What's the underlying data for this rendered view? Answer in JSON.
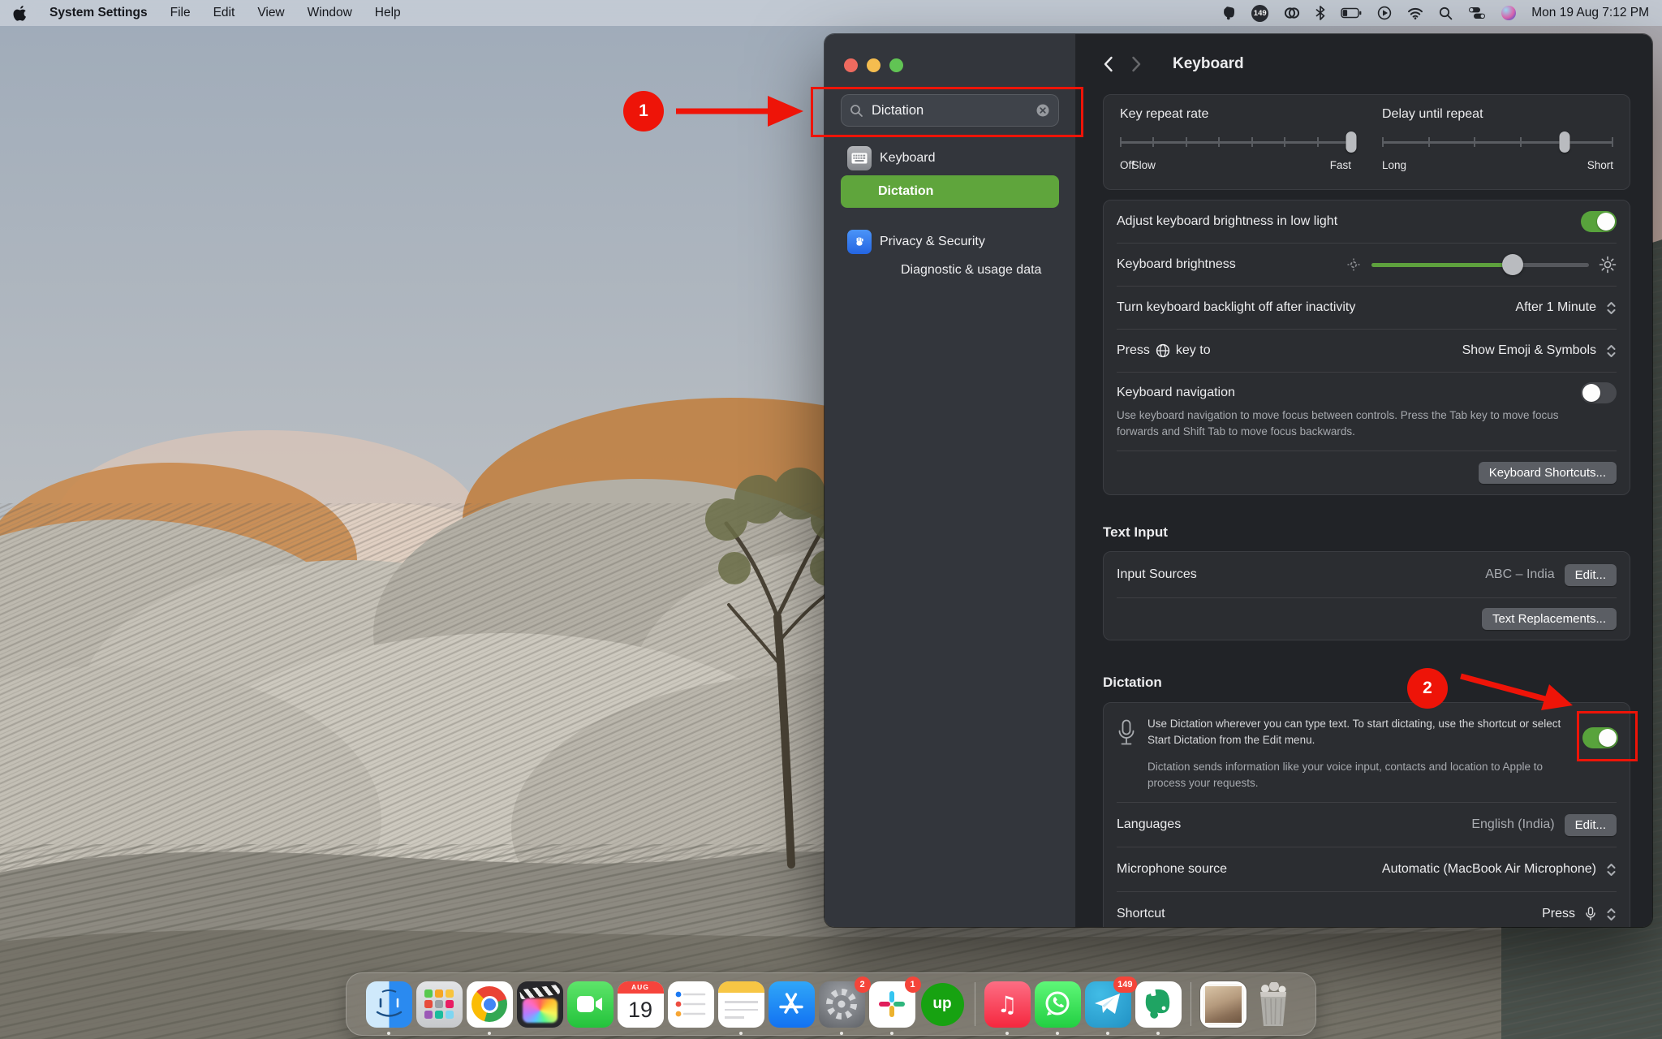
{
  "menubar": {
    "app_name": "System Settings",
    "menus": [
      "File",
      "Edit",
      "View",
      "Window",
      "Help"
    ],
    "status": {
      "telegram_badge": "149"
    },
    "clock": "Mon 19 Aug 7:12 PM"
  },
  "sidebar": {
    "search_value": "Dictation",
    "result1_parent": "Keyboard",
    "result1_child": "Dictation",
    "result2_parent": "Privacy & Security",
    "result2_child": "Diagnostic & usage data"
  },
  "main": {
    "title": "Keyboard",
    "repeat": {
      "label1": "Key repeat rate",
      "off": "Off",
      "slow": "Slow",
      "fast": "Fast",
      "key_repeat_pct": 100,
      "label2": "Delay until repeat",
      "long": "Long",
      "short": "Short",
      "delay_pct": 79
    },
    "opts": {
      "brightness_low": "Adjust keyboard brightness in low light",
      "brightness_low_on": true,
      "kb_brightness": "Keyboard brightness",
      "kb_brightness_pct": 65,
      "backlight": "Turn keyboard backlight off after inactivity",
      "backlight_value": "After 1 Minute",
      "press_prefix": "Press",
      "press_suffix": "key to",
      "press_value": "Show Emoji & Symbols",
      "nav": "Keyboard navigation",
      "nav_on": false,
      "nav_desc": "Use keyboard navigation to move focus between controls. Press the Tab key to move focus forwards and Shift Tab to move focus backwards.",
      "shortcuts_btn": "Keyboard Shortcuts..."
    },
    "text_input": {
      "header": "Text Input",
      "sources": "Input Sources",
      "sources_value": "ABC – India",
      "edit": "Edit...",
      "replacements": "Text Replacements..."
    },
    "dictation": {
      "header": "Dictation",
      "on": true,
      "desc1": "Use Dictation wherever you can type text. To start dictating, use the shortcut or select Start Dictation from the Edit menu.",
      "desc2": "Dictation sends information like your voice input, contacts and location to Apple to process your requests.",
      "languages": "Languages",
      "languages_value": "English (India)",
      "languages_edit": "Edit...",
      "mic": "Microphone source",
      "mic_value": "Automatic (MacBook Air Microphone)",
      "shortcut": "Shortcut",
      "shortcut_value": "Press"
    }
  },
  "annotations": {
    "n1": "1",
    "n2": "2"
  },
  "dock": {
    "calendar_month": "AUG",
    "calendar_day": "19",
    "upwork_label": "up",
    "badges": {
      "settings": "2",
      "slack": "1",
      "telegram": "149"
    },
    "apps": [
      {
        "name": "Finder",
        "running": true
      },
      {
        "name": "Launchpad",
        "running": false
      },
      {
        "name": "Google Chrome",
        "running": true
      },
      {
        "name": "Final Cut Pro",
        "running": false
      },
      {
        "name": "FaceTime",
        "running": false
      },
      {
        "name": "Calendar",
        "running": false
      },
      {
        "name": "Reminders",
        "running": false
      },
      {
        "name": "Notes",
        "running": true
      },
      {
        "name": "App Store",
        "running": false
      },
      {
        "name": "System Settings",
        "running": true
      },
      {
        "name": "Slack",
        "running": true
      },
      {
        "name": "Upwork",
        "running": false
      },
      {
        "name": "Music",
        "running": true
      },
      {
        "name": "WhatsApp",
        "running": true
      },
      {
        "name": "Telegram",
        "running": true
      },
      {
        "name": "Evernote",
        "running": true
      },
      {
        "name": "Image file",
        "running": false
      },
      {
        "name": "Trash",
        "running": false
      }
    ]
  },
  "colors": {
    "accent_green": "#5fa53c",
    "toggle_green": "#58a33c",
    "annotation_red": "#ee1408"
  }
}
